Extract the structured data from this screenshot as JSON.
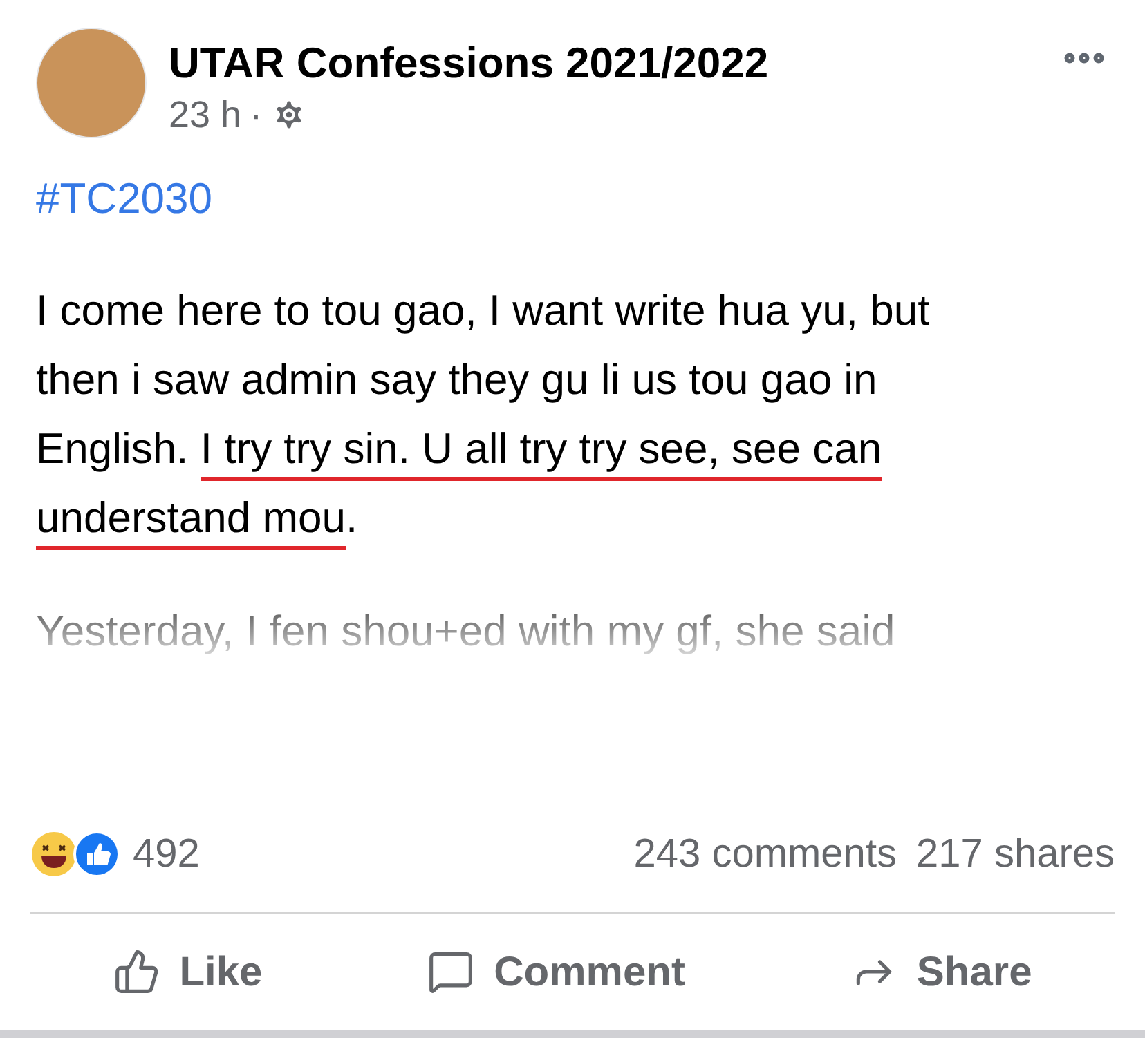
{
  "post": {
    "page_name": "UTAR Confessions 2021/2022",
    "time": "23 h",
    "separator": "·",
    "hashtag": "#TC2030",
    "paragraphs": [
      {
        "faded": false,
        "lines": [
          [
            {
              "text": "I come here to tou gao, I want write hua yu, but",
              "underlined": false
            }
          ],
          [
            {
              "text": "then i saw admin say they gu li us tou gao in",
              "underlined": false
            }
          ],
          [
            {
              "text": "English. ",
              "underlined": false
            },
            {
              "text": "I try try sin. U all try try see, see can",
              "underlined": true
            }
          ],
          [
            {
              "text": "understand mou",
              "underlined": true
            },
            {
              "text": ".",
              "underlined": false
            }
          ]
        ]
      },
      {
        "faded": true,
        "lines": [
          [
            {
              "text": "Yesterday, I fen shou+ed with my gf, she said",
              "underlined": false
            }
          ]
        ]
      }
    ]
  },
  "stats": {
    "reactions": "492",
    "comments": "243 comments",
    "shares": "217 shares"
  },
  "actions": [
    {
      "kind": "like",
      "label": "Like"
    },
    {
      "kind": "comment",
      "label": "Comment"
    },
    {
      "kind": "share",
      "label": "Share"
    }
  ]
}
